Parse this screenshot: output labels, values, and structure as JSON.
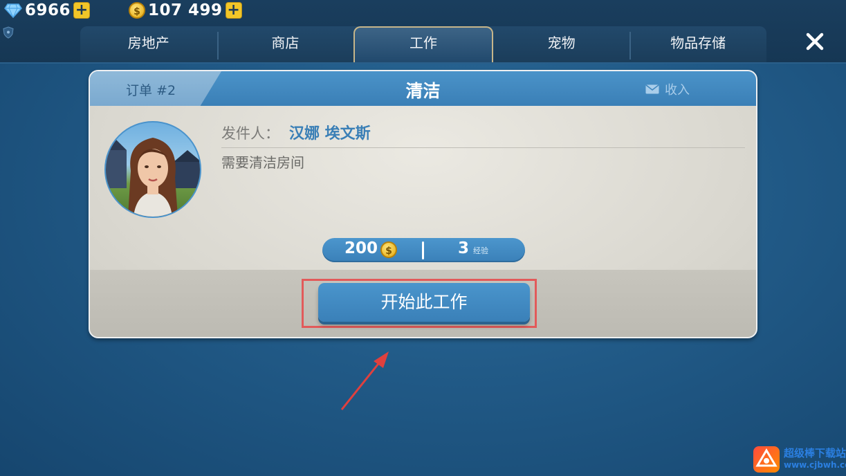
{
  "hud": {
    "gems": "6966",
    "coins": "107 499"
  },
  "tabs": [
    {
      "label": "房地产",
      "active": false
    },
    {
      "label": "商店",
      "active": false
    },
    {
      "label": "工作",
      "active": true
    },
    {
      "label": "宠物",
      "active": false
    },
    {
      "label": "物品存储",
      "active": false
    }
  ],
  "job": {
    "order_label": "订单 #2",
    "title": "清洁",
    "inbox_label": "收入",
    "sender_label": "发件人：",
    "sender_name": "汉娜 埃文斯",
    "description": "需要清洁房间",
    "reward_coins": "200",
    "reward_xp": "3",
    "reward_xp_label": "经验",
    "start_button": "开始此工作"
  },
  "watermark": {
    "name": "超级棒下载站",
    "url": "www.cjbwh.com"
  },
  "colors": {
    "accent_blue": "#3a80b8",
    "highlight_red": "#e25a5a",
    "gold": "#f2c628"
  }
}
